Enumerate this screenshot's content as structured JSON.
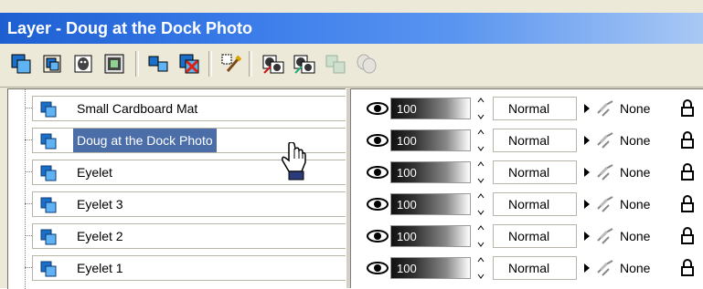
{
  "window": {
    "title": "Layer - Doug at the Dock Photo"
  },
  "toolbar": {
    "buttons": [
      "new-layer-icon",
      "new-layer-group-icon",
      "new-mask-icon",
      "mask-from-image-icon",
      "duplicate-layer-icon",
      "delete-layer-icon",
      "layer-properties-icon",
      "show-all-icon",
      "hide-all-icon",
      "invert-visibility-icon",
      "mask-visibility-icon"
    ]
  },
  "layers": [
    {
      "name": "Small Cardboard Mat",
      "opacity": "100",
      "blend": "Normal",
      "mask": "None",
      "selected": false
    },
    {
      "name": "Doug at the Dock Photo",
      "opacity": "100",
      "blend": "Normal",
      "mask": "None",
      "selected": true
    },
    {
      "name": "Eyelet",
      "opacity": "100",
      "blend": "Normal",
      "mask": "None",
      "selected": false
    },
    {
      "name": "Eyelet 3",
      "opacity": "100",
      "blend": "Normal",
      "mask": "None",
      "selected": false
    },
    {
      "name": "Eyelet 2",
      "opacity": "100",
      "blend": "Normal",
      "mask": "None",
      "selected": false
    },
    {
      "name": "Eyelet 1",
      "opacity": "100",
      "blend": "Normal",
      "mask": "None",
      "selected": false
    }
  ],
  "colors": {
    "title_bar": "#1d5fd1",
    "selection": "#4b6ea9",
    "layer_icon": "#1a6fc9"
  }
}
